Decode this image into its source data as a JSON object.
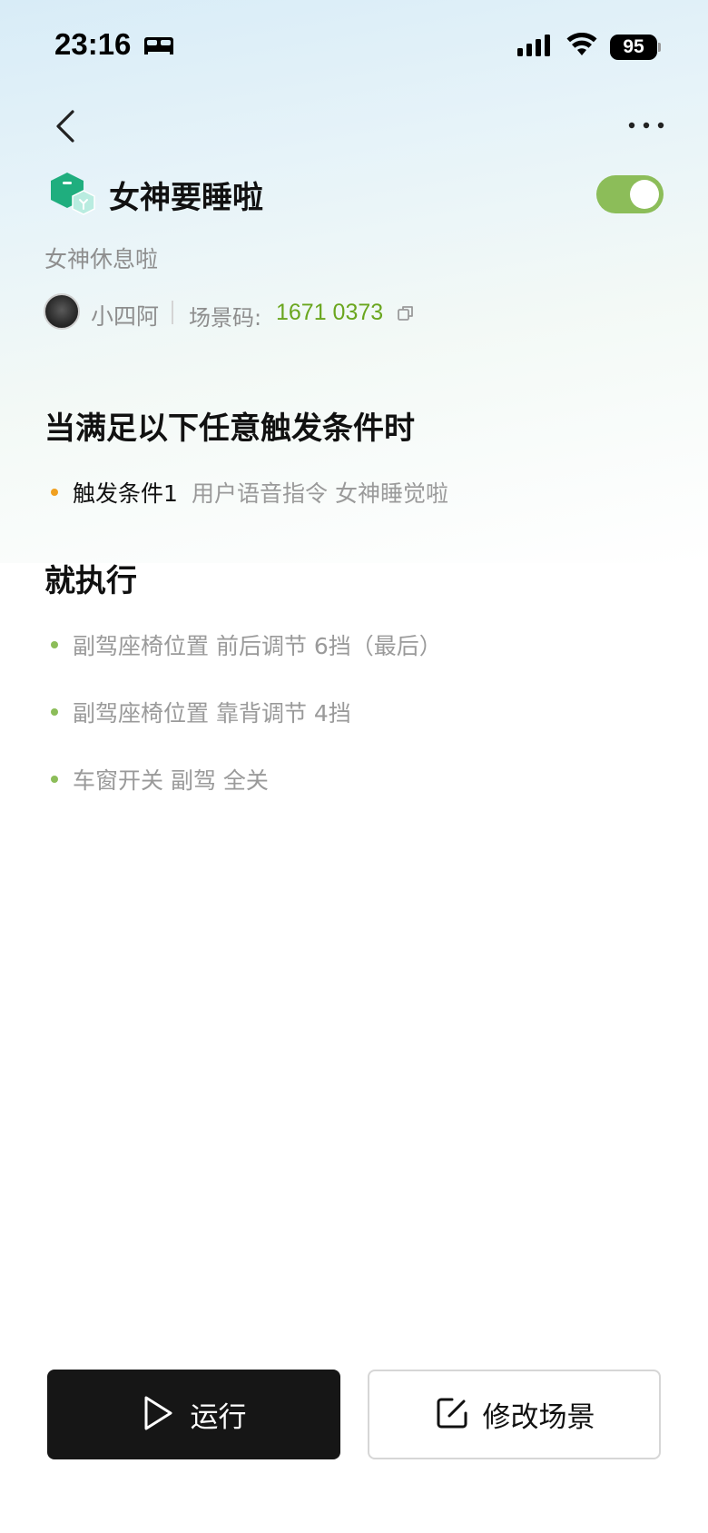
{
  "status_bar": {
    "time": "23:16",
    "battery": "95",
    "icons": [
      "bed-icon",
      "signal-icon",
      "wifi-icon",
      "battery-icon"
    ]
  },
  "nav": {
    "icons": [
      "back-icon",
      "more-icon"
    ]
  },
  "scene": {
    "title": "女神要睡啦",
    "enabled": true,
    "subtitle": "女神休息啦",
    "author": "小四阿",
    "code_label": "场景码:",
    "code_value": "1671 0373"
  },
  "trigger_section": {
    "title": "当满足以下任意触发条件时",
    "items": [
      {
        "label": "触发条件1",
        "description": "用户语音指令 女神睡觉啦"
      }
    ]
  },
  "action_section": {
    "title": "就执行",
    "items": [
      "副驾座椅位置 前后调节 6挡（最后）",
      "副驾座椅位置 靠背调节 4挡",
      "车窗开关 副驾 全关"
    ]
  },
  "buttons": {
    "run": "运行",
    "edit": "修改场景"
  },
  "colors": {
    "accent_green": "#8cbd59",
    "code_green": "#6aa61e",
    "trigger_dot": "#f0a020",
    "primary_button": "#161616"
  }
}
